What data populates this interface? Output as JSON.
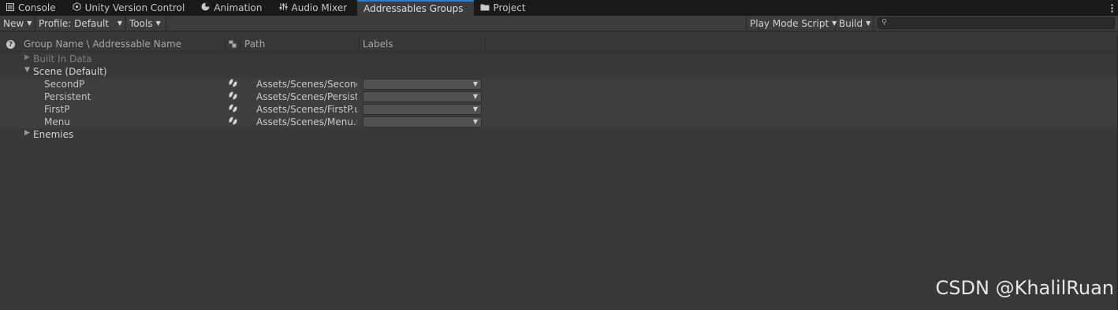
{
  "tabs": [
    {
      "label": "Console",
      "icon": "console-icon"
    },
    {
      "label": "Unity Version Control",
      "icon": "version-control-icon"
    },
    {
      "label": "Animation",
      "icon": "animation-icon"
    },
    {
      "label": "Audio Mixer",
      "icon": "audio-mixer-icon"
    },
    {
      "label": "Addressables Groups",
      "icon": "",
      "active": true
    },
    {
      "label": "Project",
      "icon": "folder-icon"
    }
  ],
  "toolbar": {
    "new_label": "New",
    "profile_label": "Profile: Default",
    "tools_label": "Tools",
    "play_mode_label": "Play Mode Script",
    "build_label": "Build",
    "search_value": ""
  },
  "columns": {
    "group_name": "Group Name \\ Addressable Name",
    "path": "Path",
    "labels": "Labels"
  },
  "tree": {
    "built_in": "Built In Data",
    "scene_group": "Scene (Default)",
    "entries": [
      {
        "name": "SecondP",
        "path": "Assets/Scenes/SecondP.unity"
      },
      {
        "name": "Persistent",
        "path": "Assets/Scenes/Persistent.unity"
      },
      {
        "name": "FirstP",
        "path": "Assets/Scenes/FirstP.unity"
      },
      {
        "name": "Menu",
        "path": "Assets/Scenes/Menu.unity"
      }
    ],
    "enemies": "Enemies"
  },
  "watermark": "CSDN @KhalilRuan",
  "colors": {
    "accent": "#3a79bb",
    "background": "#383838",
    "tabbar": "#191919"
  }
}
